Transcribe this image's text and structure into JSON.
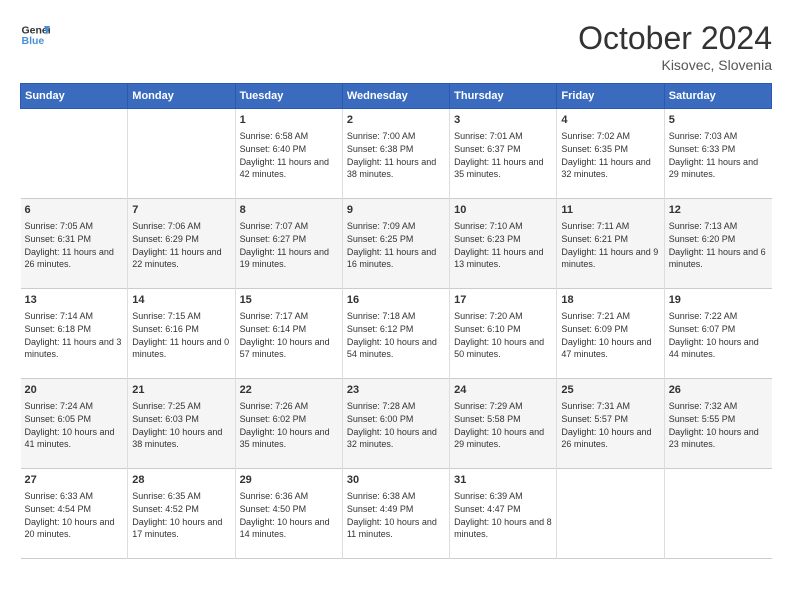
{
  "header": {
    "logo_line1": "General",
    "logo_line2": "Blue",
    "month": "October 2024",
    "location": "Kisovec, Slovenia"
  },
  "weekdays": [
    "Sunday",
    "Monday",
    "Tuesday",
    "Wednesday",
    "Thursday",
    "Friday",
    "Saturday"
  ],
  "weeks": [
    [
      {
        "day": "",
        "info": ""
      },
      {
        "day": "",
        "info": ""
      },
      {
        "day": "1",
        "info": "Sunrise: 6:58 AM\nSunset: 6:40 PM\nDaylight: 11 hours and 42 minutes."
      },
      {
        "day": "2",
        "info": "Sunrise: 7:00 AM\nSunset: 6:38 PM\nDaylight: 11 hours and 38 minutes."
      },
      {
        "day": "3",
        "info": "Sunrise: 7:01 AM\nSunset: 6:37 PM\nDaylight: 11 hours and 35 minutes."
      },
      {
        "day": "4",
        "info": "Sunrise: 7:02 AM\nSunset: 6:35 PM\nDaylight: 11 hours and 32 minutes."
      },
      {
        "day": "5",
        "info": "Sunrise: 7:03 AM\nSunset: 6:33 PM\nDaylight: 11 hours and 29 minutes."
      }
    ],
    [
      {
        "day": "6",
        "info": "Sunrise: 7:05 AM\nSunset: 6:31 PM\nDaylight: 11 hours and 26 minutes."
      },
      {
        "day": "7",
        "info": "Sunrise: 7:06 AM\nSunset: 6:29 PM\nDaylight: 11 hours and 22 minutes."
      },
      {
        "day": "8",
        "info": "Sunrise: 7:07 AM\nSunset: 6:27 PM\nDaylight: 11 hours and 19 minutes."
      },
      {
        "day": "9",
        "info": "Sunrise: 7:09 AM\nSunset: 6:25 PM\nDaylight: 11 hours and 16 minutes."
      },
      {
        "day": "10",
        "info": "Sunrise: 7:10 AM\nSunset: 6:23 PM\nDaylight: 11 hours and 13 minutes."
      },
      {
        "day": "11",
        "info": "Sunrise: 7:11 AM\nSunset: 6:21 PM\nDaylight: 11 hours and 9 minutes."
      },
      {
        "day": "12",
        "info": "Sunrise: 7:13 AM\nSunset: 6:20 PM\nDaylight: 11 hours and 6 minutes."
      }
    ],
    [
      {
        "day": "13",
        "info": "Sunrise: 7:14 AM\nSunset: 6:18 PM\nDaylight: 11 hours and 3 minutes."
      },
      {
        "day": "14",
        "info": "Sunrise: 7:15 AM\nSunset: 6:16 PM\nDaylight: 11 hours and 0 minutes."
      },
      {
        "day": "15",
        "info": "Sunrise: 7:17 AM\nSunset: 6:14 PM\nDaylight: 10 hours and 57 minutes."
      },
      {
        "day": "16",
        "info": "Sunrise: 7:18 AM\nSunset: 6:12 PM\nDaylight: 10 hours and 54 minutes."
      },
      {
        "day": "17",
        "info": "Sunrise: 7:20 AM\nSunset: 6:10 PM\nDaylight: 10 hours and 50 minutes."
      },
      {
        "day": "18",
        "info": "Sunrise: 7:21 AM\nSunset: 6:09 PM\nDaylight: 10 hours and 47 minutes."
      },
      {
        "day": "19",
        "info": "Sunrise: 7:22 AM\nSunset: 6:07 PM\nDaylight: 10 hours and 44 minutes."
      }
    ],
    [
      {
        "day": "20",
        "info": "Sunrise: 7:24 AM\nSunset: 6:05 PM\nDaylight: 10 hours and 41 minutes."
      },
      {
        "day": "21",
        "info": "Sunrise: 7:25 AM\nSunset: 6:03 PM\nDaylight: 10 hours and 38 minutes."
      },
      {
        "day": "22",
        "info": "Sunrise: 7:26 AM\nSunset: 6:02 PM\nDaylight: 10 hours and 35 minutes."
      },
      {
        "day": "23",
        "info": "Sunrise: 7:28 AM\nSunset: 6:00 PM\nDaylight: 10 hours and 32 minutes."
      },
      {
        "day": "24",
        "info": "Sunrise: 7:29 AM\nSunset: 5:58 PM\nDaylight: 10 hours and 29 minutes."
      },
      {
        "day": "25",
        "info": "Sunrise: 7:31 AM\nSunset: 5:57 PM\nDaylight: 10 hours and 26 minutes."
      },
      {
        "day": "26",
        "info": "Sunrise: 7:32 AM\nSunset: 5:55 PM\nDaylight: 10 hours and 23 minutes."
      }
    ],
    [
      {
        "day": "27",
        "info": "Sunrise: 6:33 AM\nSunset: 4:54 PM\nDaylight: 10 hours and 20 minutes."
      },
      {
        "day": "28",
        "info": "Sunrise: 6:35 AM\nSunset: 4:52 PM\nDaylight: 10 hours and 17 minutes."
      },
      {
        "day": "29",
        "info": "Sunrise: 6:36 AM\nSunset: 4:50 PM\nDaylight: 10 hours and 14 minutes."
      },
      {
        "day": "30",
        "info": "Sunrise: 6:38 AM\nSunset: 4:49 PM\nDaylight: 10 hours and 11 minutes."
      },
      {
        "day": "31",
        "info": "Sunrise: 6:39 AM\nSunset: 4:47 PM\nDaylight: 10 hours and 8 minutes."
      },
      {
        "day": "",
        "info": ""
      },
      {
        "day": "",
        "info": ""
      }
    ]
  ]
}
